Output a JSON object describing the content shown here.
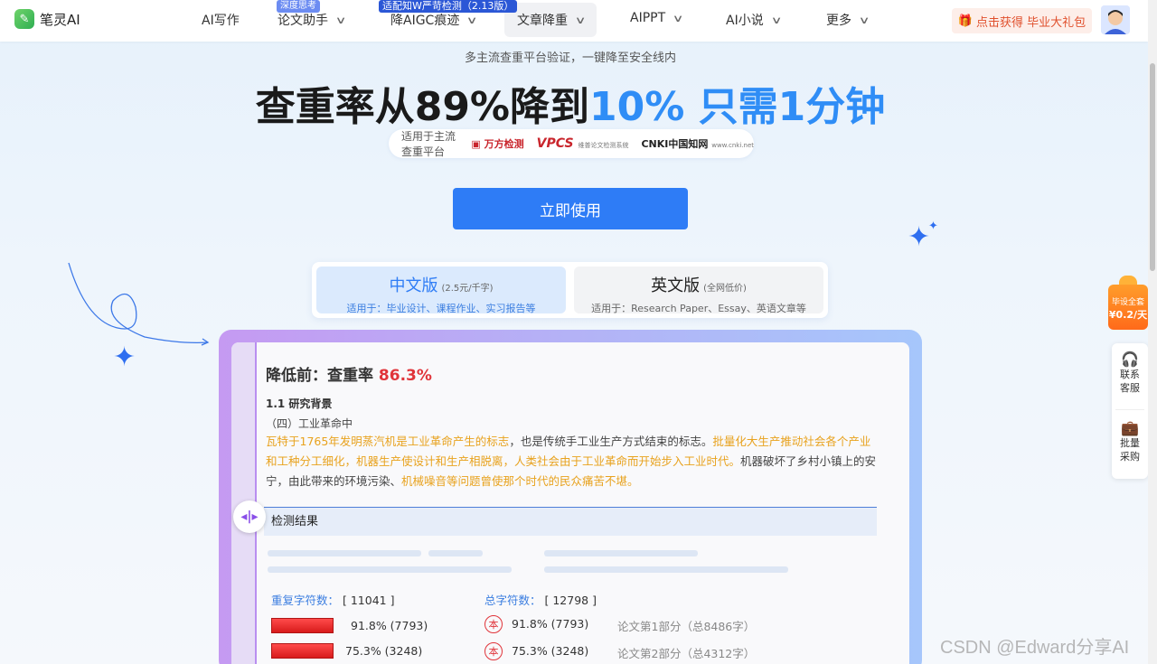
{
  "nav": {
    "logo_text": "笔灵AI",
    "items": [
      {
        "label": "AI写作",
        "has_dropdown": false
      },
      {
        "label": "论文助手",
        "has_dropdown": true,
        "badge": "深度思考"
      },
      {
        "label": "降AIGC痕迹",
        "has_dropdown": true,
        "badge": "适配知W严苛检测（2.13版）"
      },
      {
        "label": "文章降重",
        "has_dropdown": true,
        "active": true
      },
      {
        "label": "AIPPT",
        "has_dropdown": true
      },
      {
        "label": "AI小说",
        "has_dropdown": true
      },
      {
        "label": "更多",
        "has_dropdown": true
      }
    ],
    "gift_button": "点击获得 毕业大礼包",
    "gift_icon": "gift-icon",
    "avatar_icon": "user-avatar"
  },
  "hero": {
    "subtitle": "多主流查重平台验证，一键降至安全线内",
    "headline_dark": "查重率从89%降到",
    "headline_blue": "10% 只需1分钟",
    "platforms_label": "适用于主流查重平台",
    "platform_logos": [
      {
        "name": "万方检测"
      },
      {
        "name": "VPCS",
        "sub": "维普论文检测系统"
      },
      {
        "name": "CNKI中国知网",
        "sub": "www.cnki.net"
      }
    ],
    "cta": "立即使用"
  },
  "versions": [
    {
      "title": "中文版",
      "price": "(2.5元/千字)",
      "desc": "适用于：毕业设计、课程作业、实习报告等",
      "selected": true
    },
    {
      "title": "英文版",
      "price": "(全网低价)",
      "desc": "适用于：Research Paper、Essay、英语文章等",
      "selected": false
    }
  ],
  "card": {
    "heading_prefix": "降低前：查重率",
    "heading_value": "86.3%",
    "section_title": "1.1 研究背景",
    "section_sub": "（四）工业革命中",
    "para_parts": [
      {
        "text": "瓦特于1765年发明蒸汽机是工业革命产生的标志",
        "highlight": true
      },
      {
        "text": "，也是传统手工业生产方式结束的标志。",
        "highlight": false
      },
      {
        "text": "批量化大生产推动社会各个产业和工种分工细化，机器生产使设计和生产相脱离，人类社会由于工业革命而开始步入工业时代。",
        "highlight": true
      },
      {
        "text": "机器破坏了乡村小镇上的安宁，由此带来的环境污染、",
        "highlight": false
      },
      {
        "text": "机械噪音等问题曾使那个时代的民众痛苦不堪。",
        "highlight": true
      }
    ],
    "result_bar": "检测结果",
    "repeat_label": "重复字符数：",
    "repeat_value": "[ 11041 ]",
    "total_label": "总字符数：",
    "total_value": "[ 12798 ]",
    "rows": [
      {
        "bar_text": "91.8% (7793)",
        "seal": "本",
        "seal_text": "91.8% (7793)",
        "part": "论文第1部分（总8486字）"
      },
      {
        "bar_text": "75.3% (3248)",
        "seal": "本",
        "seal_text": "75.3% (3248)",
        "part": "论文第2部分（总4312字）"
      }
    ]
  },
  "float": {
    "gift_line1": "毕设全套",
    "gift_line2": "¥0.2/天",
    "service_label": "联系客服",
    "service_icon": "headset-icon",
    "bulk_label": "批量采购",
    "bulk_icon": "briefcase-icon"
  },
  "watermark": "CSDN @Edward分享AI",
  "colors": {
    "accent_blue": "#2e7cf6",
    "headline_blue": "#2f8df6",
    "highlight_orange": "#e8a21e",
    "rate_red": "#e0343a"
  }
}
